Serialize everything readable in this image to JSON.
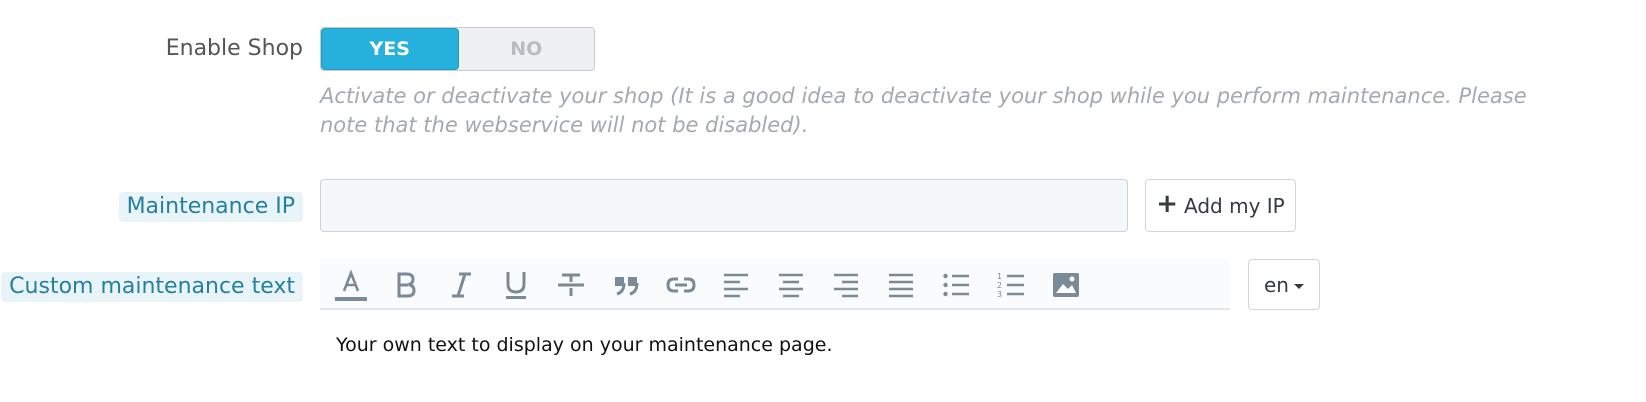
{
  "enable_shop": {
    "label": "Enable Shop",
    "yes_label": "YES",
    "no_label": "NO",
    "selected": "YES",
    "help": "Activate or deactivate your shop (It is a good idea to deactivate your shop while you perform maintenance. Please note that the webservice will not be disabled)."
  },
  "maintenance_ip": {
    "label": "Maintenance IP",
    "value": "",
    "add_button_label": "Add my IP",
    "add_button_icon": "plus-icon"
  },
  "custom_text": {
    "label": "Custom maintenance text",
    "toolbar_icons": [
      "text-color-icon",
      "bold-icon",
      "italic-icon",
      "underline-icon",
      "strikethrough-icon",
      "blockquote-icon",
      "link-icon",
      "align-left-icon",
      "align-center-icon",
      "align-right-icon",
      "align-justify-icon",
      "bullet-list-icon",
      "numbered-list-icon",
      "image-icon"
    ],
    "language": "en",
    "content": "Your own text to display on your maintenance page."
  },
  "colors": {
    "accent": "#25b1dc",
    "label_hint": "#25809f",
    "icon": "#7a8a96"
  }
}
